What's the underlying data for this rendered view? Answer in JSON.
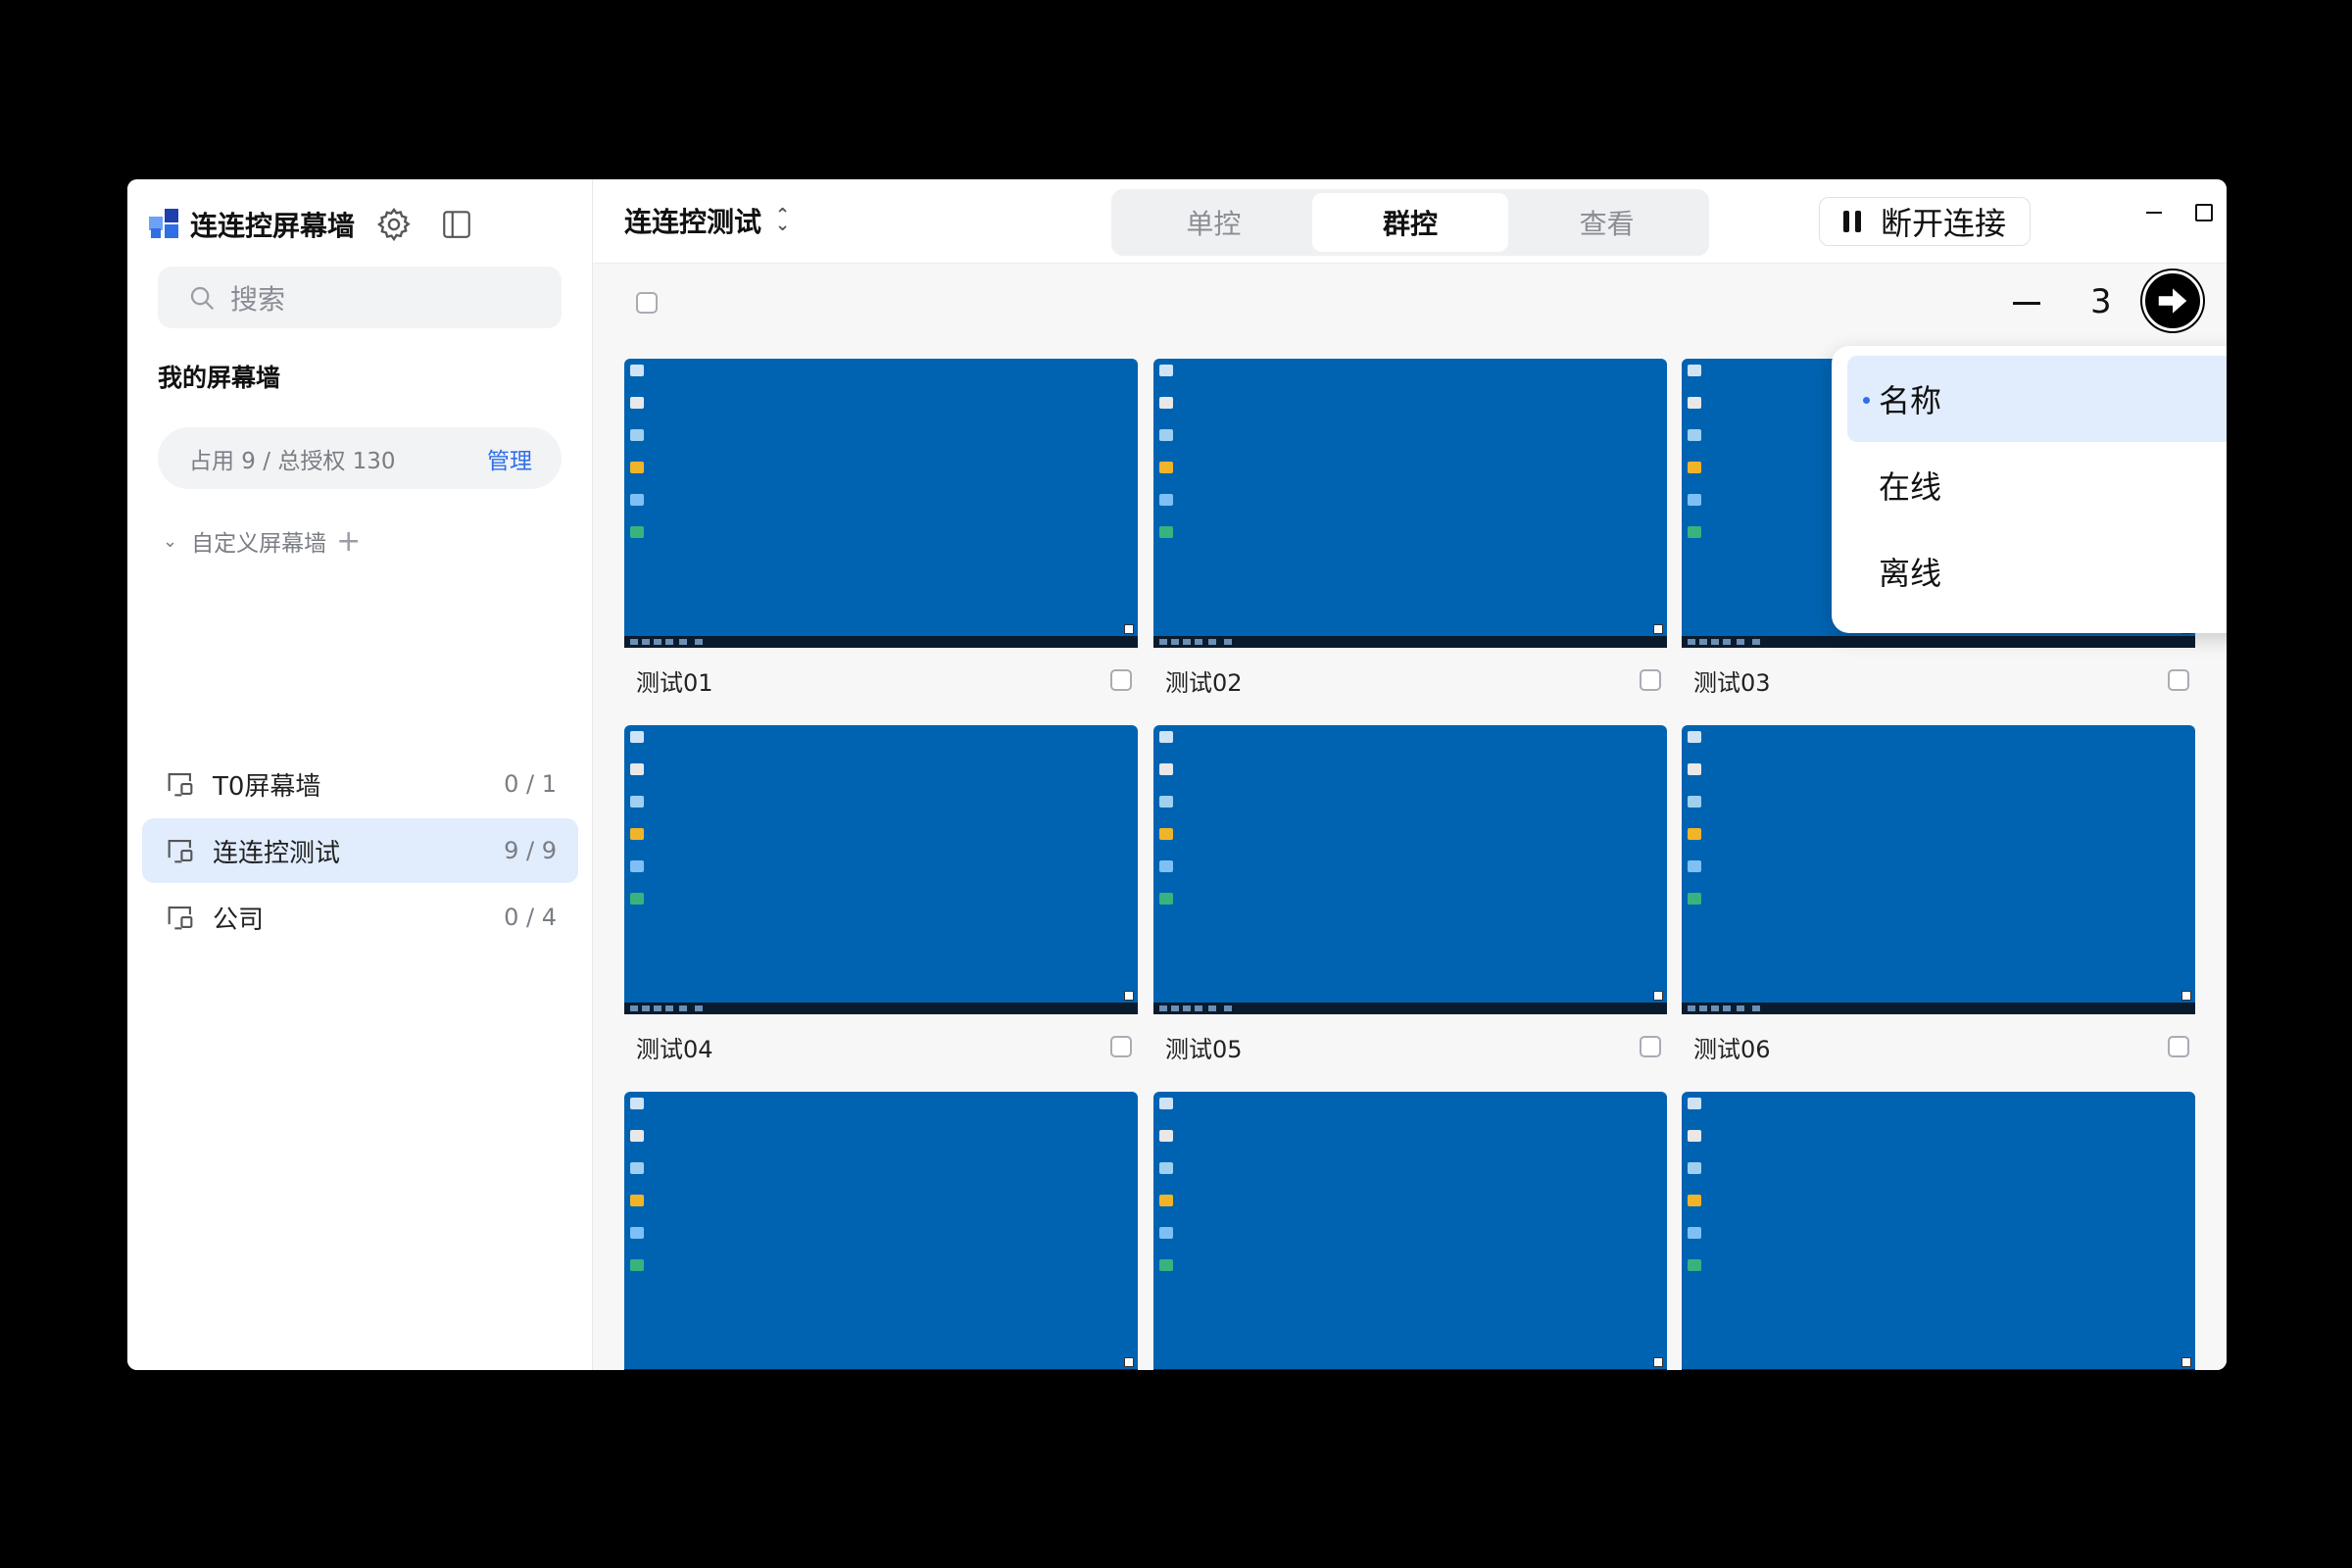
{
  "app": {
    "title": "连连控屏幕墙",
    "brand_colors": [
      "#2f6fe8",
      "#6ea0f5",
      "#1f3fae"
    ]
  },
  "sidebar": {
    "search_placeholder": "搜索",
    "section_title": "我的屏幕墙",
    "usage_text": "占用 9 / 总授权 130",
    "manage_label": "管理",
    "custom_group_label": "自定义屏幕墙",
    "walls": [
      {
        "name": "T0屏幕墙",
        "count": "0 / 1",
        "active": false
      },
      {
        "name": "连连控测试",
        "count": "9 / 9",
        "active": true
      },
      {
        "name": "公司",
        "count": "0 / 4",
        "active": false
      }
    ]
  },
  "topbar": {
    "current_wall": "连连控测试",
    "tabs": [
      {
        "label": "单控",
        "active": false
      },
      {
        "label": "群控",
        "active": true
      },
      {
        "label": "查看",
        "active": false
      }
    ],
    "disconnect_label": "断开连接"
  },
  "toolbar": {
    "columns_value": "3",
    "sort_label": "名称"
  },
  "sort_menu": {
    "items": [
      {
        "label": "名称",
        "selected": true
      },
      {
        "label": "在线",
        "selected": false
      },
      {
        "label": "离线",
        "selected": false
      }
    ]
  },
  "tiles": [
    {
      "label": "测试01"
    },
    {
      "label": "测试02"
    },
    {
      "label": "测试03"
    },
    {
      "label": "测试04"
    },
    {
      "label": "测试05"
    },
    {
      "label": "测试06"
    },
    {
      "label": ""
    },
    {
      "label": ""
    },
    {
      "label": ""
    }
  ],
  "colors": {
    "accent": "#2f6fe8",
    "active_bg": "#e1ecfd",
    "desktop_blue": "#0063b1"
  }
}
